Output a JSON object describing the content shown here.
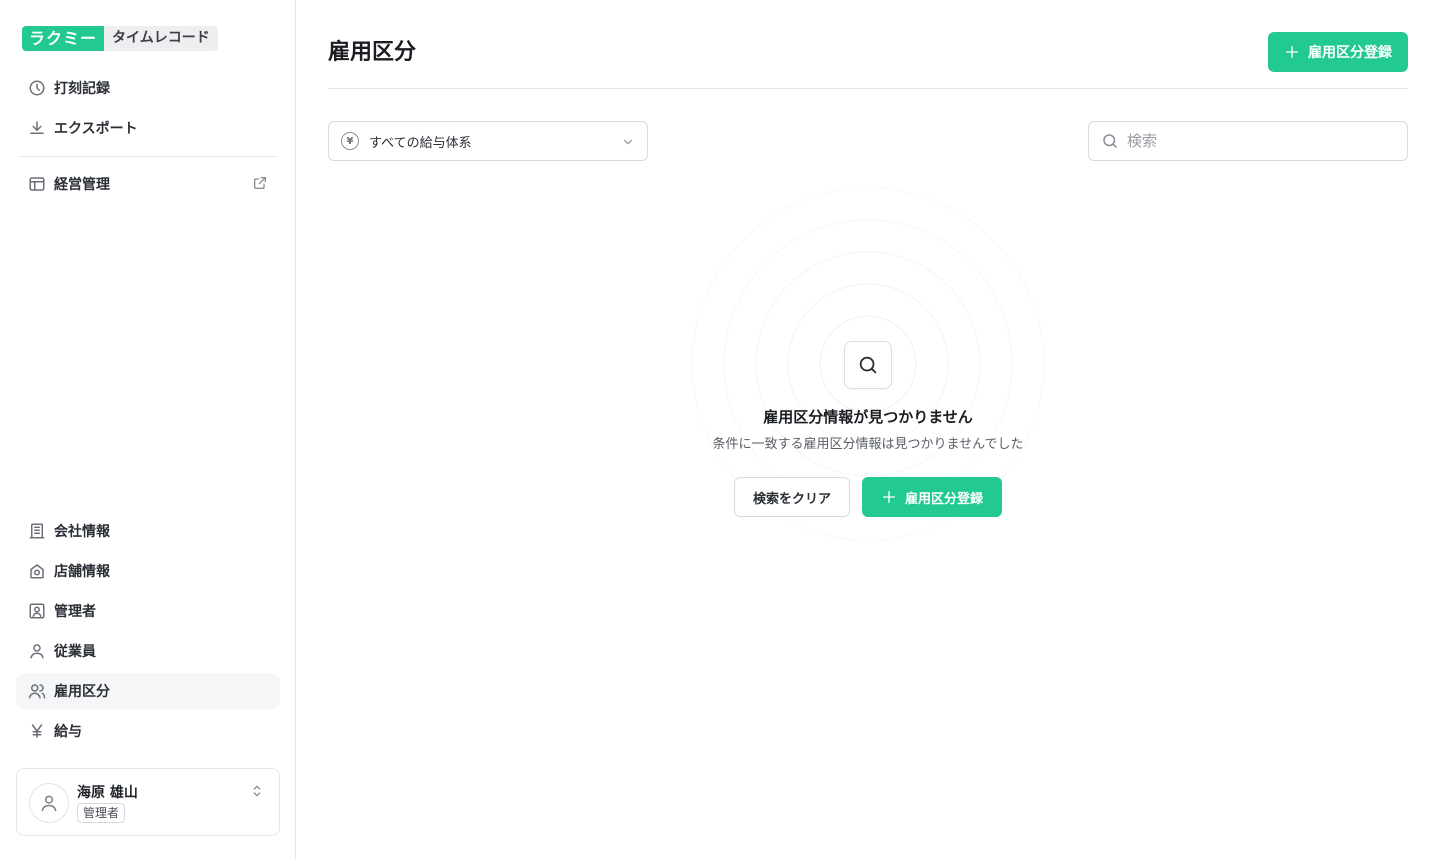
{
  "logo": {
    "brand": "ラクミー",
    "product": "タイムレコード"
  },
  "sidebar": {
    "top_items": [
      {
        "label": "打刻記録",
        "icon": "clock-icon"
      },
      {
        "label": "エクスポート",
        "icon": "download-icon"
      },
      {
        "label": "経営管理",
        "icon": "layout-icon",
        "external": true
      }
    ],
    "bottom_items": [
      {
        "label": "会社情報",
        "icon": "building-icon"
      },
      {
        "label": "店舗情報",
        "icon": "store-icon"
      },
      {
        "label": "管理者",
        "icon": "admin-icon"
      },
      {
        "label": "従業員",
        "icon": "user-icon"
      },
      {
        "label": "雇用区分",
        "icon": "users-icon",
        "active": true
      },
      {
        "label": "給与",
        "icon": "yen-icon"
      }
    ]
  },
  "user": {
    "name": "海原 雄山",
    "role": "管理者"
  },
  "header": {
    "title": "雇用区分",
    "add_button": "雇用区分登録"
  },
  "filters": {
    "salary_select": "すべての給与体系",
    "search_placeholder": "検索"
  },
  "empty_state": {
    "title": "雇用区分情報が見つかりません",
    "description": "条件に一致する雇用区分情報は見つかりませんでした",
    "clear_button": "検索をクリア",
    "add_button": "雇用区分登録"
  },
  "colors": {
    "accent": "#22c993",
    "border": "#d9dade"
  }
}
